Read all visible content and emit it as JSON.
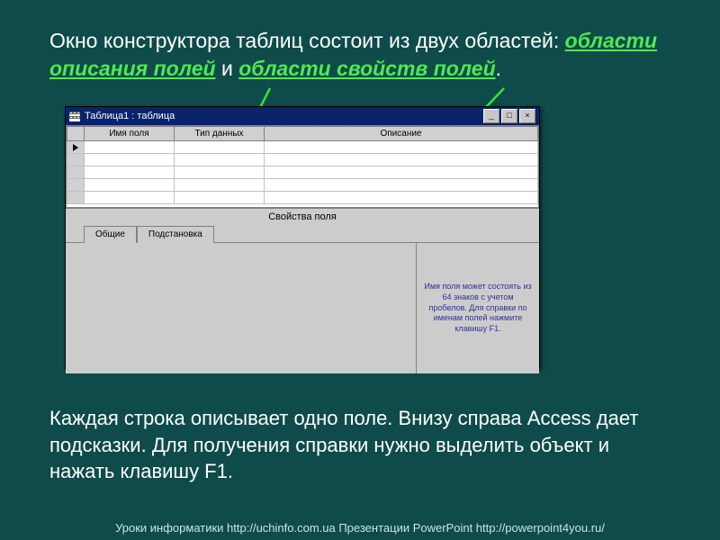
{
  "heading": {
    "pre": "Окно конструктора таблиц состоит из двух областей: ",
    "link1": "области описания полей",
    "mid": " и ",
    "link2": "области свойств полей",
    "post": "."
  },
  "window": {
    "title": "Таблица1 : таблица",
    "controls": {
      "min": "_",
      "max": "□",
      "close": "×"
    }
  },
  "grid": {
    "col_name": "Имя поля",
    "col_type": "Тип данных",
    "col_desc": "Описание"
  },
  "section_label": "Свойства поля",
  "tabs": {
    "general": "Общие",
    "lookup": "Подстановка"
  },
  "hint": "Имя поля может состоять из 64 знаков с учетом пробелов. Для справки по именам полей нажмите клавишу F1.",
  "description": "Каждая строка описывает одно поле. Внизу справа Access дает подсказки. Для получения справки нужно выделить объект и нажать клавишу F1.",
  "footer": "Уроки информатики  http://uchinfo.com.ua     Презентации PowerPoint  http://powerpoint4you.ru/"
}
